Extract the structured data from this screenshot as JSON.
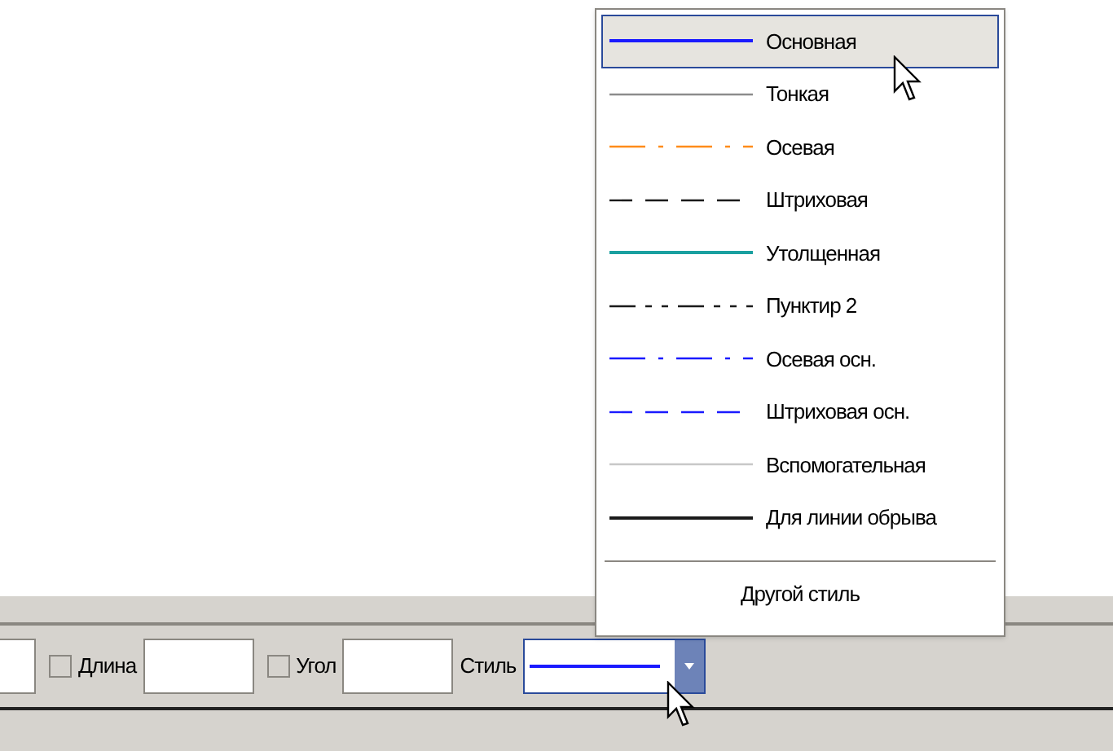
{
  "toolbar": {
    "fields": [
      {
        "kind": "input",
        "label": "Длина",
        "checked": false
      },
      {
        "kind": "input",
        "label": "Угол",
        "checked": false
      }
    ],
    "style": {
      "label": "Стиль",
      "color": "#1a1aff",
      "kind": "thick"
    }
  },
  "style_menu": {
    "items": [
      {
        "label": "Основная",
        "kind": "thick",
        "color": "#1a1aff",
        "selected": true
      },
      {
        "label": "Тонкая",
        "kind": "solid",
        "color": "#8c8c8c",
        "selected": false
      },
      {
        "label": "Осевая",
        "kind": "dashdot",
        "color": "#ff8c1a",
        "selected": false
      },
      {
        "label": "Штриховая",
        "kind": "dashed",
        "color": "#1a1a1a",
        "selected": false
      },
      {
        "label": "Утолщенная",
        "kind": "thick",
        "color": "#1aa0a0",
        "selected": false
      },
      {
        "label": "Пунктир 2",
        "kind": "dashdotdot",
        "color": "#1a1a1a",
        "selected": false
      },
      {
        "label": "Осевая осн.",
        "kind": "dashdot",
        "color": "#1a1aff",
        "selected": false
      },
      {
        "label": "Штриховая осн.",
        "kind": "dashed",
        "color": "#1a1aff",
        "selected": false
      },
      {
        "label": "Вспомогательная",
        "kind": "solid",
        "color": "#c8c8c8",
        "selected": false
      },
      {
        "label": "Для линии обрыва",
        "kind": "thick",
        "color": "#1a1a1a",
        "selected": false
      }
    ],
    "other": "Другой стиль"
  }
}
